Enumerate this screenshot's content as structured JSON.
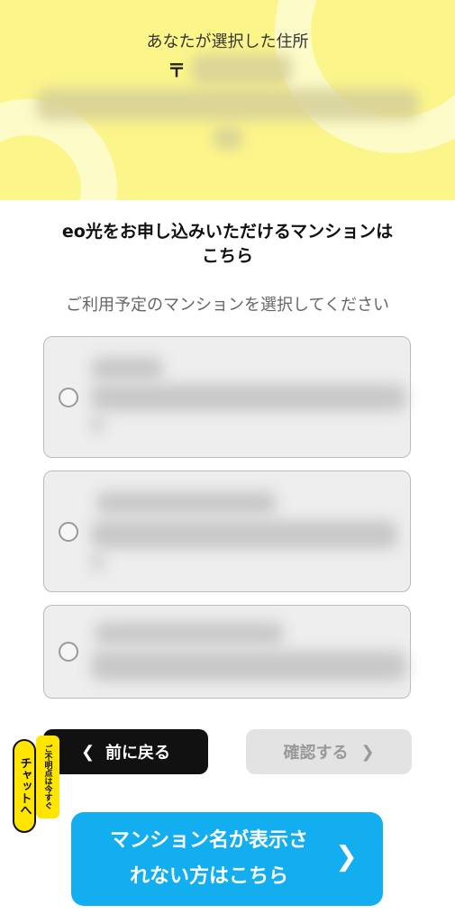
{
  "address": {
    "title": "あなたが選択した住所",
    "postal_mark": "〒"
  },
  "heading": {
    "line1": "eo光をお申し込みいただけるマンションは",
    "line2": "こちら"
  },
  "instruction": "ご利用予定のマンションを選択してください",
  "options": [
    {
      "selected": false
    },
    {
      "selected": false
    },
    {
      "selected": false
    }
  ],
  "buttons": {
    "back": "前に戻る",
    "back_icon": "chevron-left",
    "confirm": "確認する",
    "confirm_icon": "chevron-right"
  },
  "chat": {
    "main": "チャットへ",
    "sub": "ご不明点は今すぐ"
  },
  "cta": {
    "line1": "マンション名が表示さ",
    "line2": "れない方はこちら",
    "icon": "chevron-right"
  },
  "colors": {
    "header_bg": "#fcf58a",
    "cta_bg": "#12aef0",
    "chat_bg": "#ffe500"
  }
}
